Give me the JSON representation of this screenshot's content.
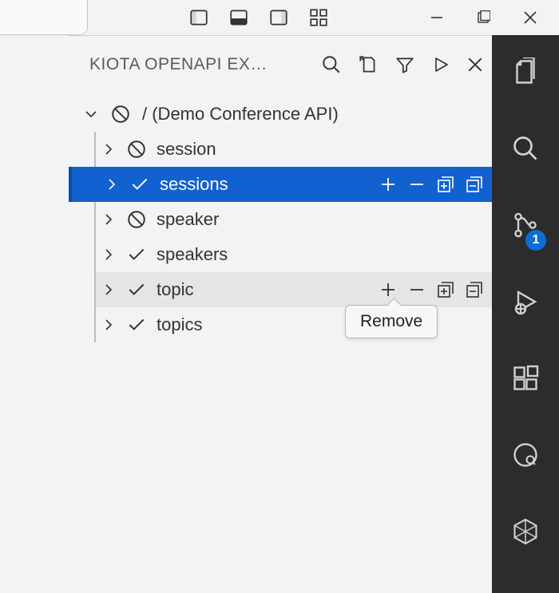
{
  "panel": {
    "title": "KIOTA OPENAPI EX…"
  },
  "tree": {
    "root_label": "/ (Demo Conference API)",
    "items": [
      {
        "label": "session",
        "state": "excluded",
        "selected": false,
        "hover": false
      },
      {
        "label": "sessions",
        "state": "included",
        "selected": true,
        "hover": false
      },
      {
        "label": "speaker",
        "state": "excluded",
        "selected": false,
        "hover": false
      },
      {
        "label": "speakers",
        "state": "included",
        "selected": false,
        "hover": false
      },
      {
        "label": "topic",
        "state": "included",
        "selected": false,
        "hover": true
      },
      {
        "label": "topics",
        "state": "included",
        "selected": false,
        "hover": false
      }
    ]
  },
  "row_actions": {
    "add": "Add",
    "remove": "Remove",
    "add_all": "Add all",
    "remove_all": "Remove all"
  },
  "tooltip": "Remove",
  "activitybar": {
    "scm_badge": "1"
  }
}
